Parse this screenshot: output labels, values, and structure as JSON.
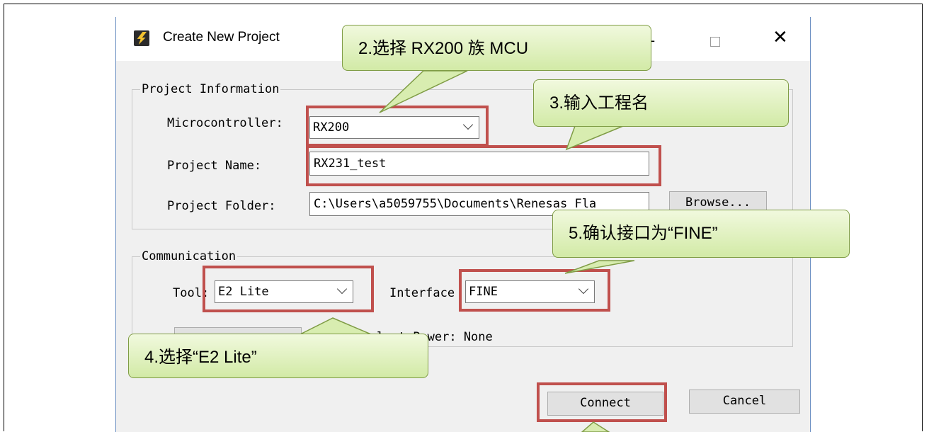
{
  "window": {
    "title": "Create New Project"
  },
  "project_info": {
    "group_label": "Project Information",
    "microcontroller_label": "Microcontroller:",
    "microcontroller_value": "RX200",
    "project_name_label": "Project Name:",
    "project_name_value": "RX231_test",
    "project_folder_label": "Project Folder:",
    "project_folder_value": "C:\\Users\\a5059755\\Documents\\Renesas Fla",
    "browse_label": "Browse..."
  },
  "communication": {
    "group_label": "Communication",
    "tool_label": "Tool:",
    "tool_value": "E2 Lite",
    "interface_label": "Interface",
    "interface_value": "FINE",
    "tool_details_fragment": "lect  Power: None"
  },
  "footer": {
    "connect_label": "Connect",
    "cancel_label": "Cancel"
  },
  "callouts": {
    "step2": "2.选择 RX200 族 MCU",
    "step3": "3.输入工程名",
    "step4": "4.选择“E2 Lite”",
    "step5": "5.确认接口为“FINE”"
  },
  "colors": {
    "highlight": "#c0504d",
    "callout_fill": "#e4f2c6",
    "callout_border": "#7f9c45"
  }
}
